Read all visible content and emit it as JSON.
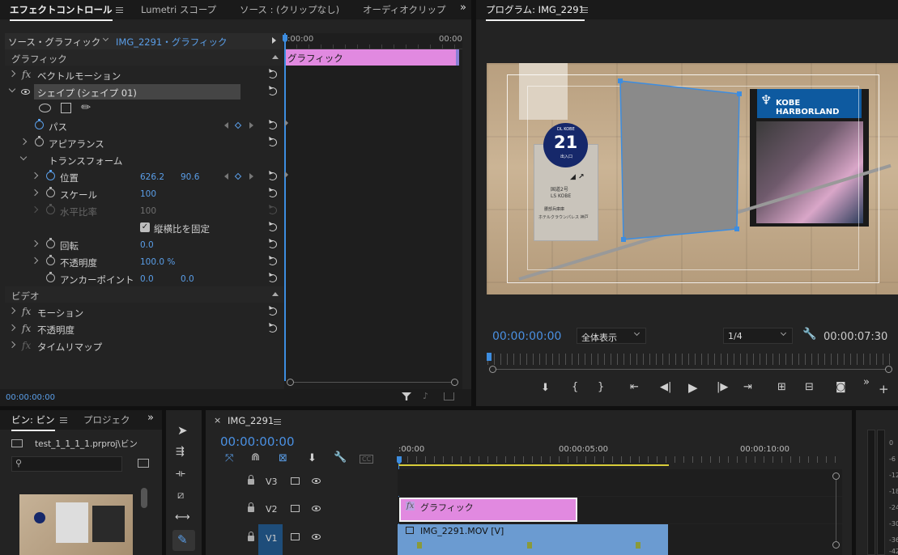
{
  "effect_controls": {
    "tabs": [
      "エフェクトコントロール",
      "Lumetri スコープ",
      "ソース : (クリップなし)",
      "オーディオクリップ"
    ],
    "source_label": "ソース・グラフィック",
    "clip_label": "IMG_2291・グラフィック",
    "ruler_start": ":00:00",
    "ruler_end": "00:00",
    "clip_bar_label": "グラフィック",
    "section_graphic": "グラフィック",
    "vector_motion": "ベクトルモーション",
    "shape": "シェイプ (シェイプ 01)",
    "path": "パス",
    "appearance": "アピアランス",
    "transform": "トランスフォーム",
    "position": {
      "label": "位置",
      "x": "626.2",
      "y": "90.6"
    },
    "scale": {
      "label": "スケール",
      "value": "100"
    },
    "h_scale": {
      "label": "水平比率",
      "value": "100"
    },
    "lock_aspect": "縦横比を固定",
    "rotation": {
      "label": "回転",
      "value": "0.0"
    },
    "opacity": {
      "label": "不透明度",
      "value": "100.0 %"
    },
    "anchor": {
      "label": "アンカーポイント",
      "x": "0.0",
      "y": "0.0"
    },
    "section_video": "ビデオ",
    "motion": "モーション",
    "video_opacity": "不透明度",
    "time_remap": "タイムリマップ",
    "timecode": "00:00:00:00"
  },
  "program_monitor": {
    "title": "プログラム: IMG_2291",
    "timecode": "00:00:00:00",
    "zoom": "全体表示",
    "resolution": "1/4",
    "duration": "00:00:07:30",
    "scene_text": {
      "badge_small": "DL KOBE",
      "badge_number": "21",
      "badge_sub": "出入口",
      "sign_lines": [
        "国道2号",
        "LS KOBE",
        "腰部兵庫庫",
        "ホテルクラウンパレス 神戸"
      ],
      "map_title": "KOBE HARBORLAND"
    }
  },
  "project_panel": {
    "tabs": [
      "ビン: ビン",
      "プロジェク"
    ],
    "path": "test_1_1_1_1.prproj\\ビン"
  },
  "timeline": {
    "sequence": "IMG_2291",
    "timecode": "00:00:00:00",
    "ruler": [
      ":00:00",
      "00:00:05:00",
      "00:00:10:00"
    ],
    "tracks": [
      {
        "name": "V3"
      },
      {
        "name": "V2",
        "clip": "グラフィック"
      },
      {
        "name": "V1",
        "clip": "IMG_2291.MOV [V]"
      }
    ]
  },
  "audio_meter": {
    "labels": [
      "0",
      "-6",
      "-12",
      "-18",
      "-24",
      "-30",
      "-36",
      "-42"
    ]
  },
  "colors": {
    "accent_blue": "#4a90e2",
    "graphic_clip": "#e189e0",
    "video_clip": "#6b9bd1",
    "panel_bg": "#232323"
  }
}
